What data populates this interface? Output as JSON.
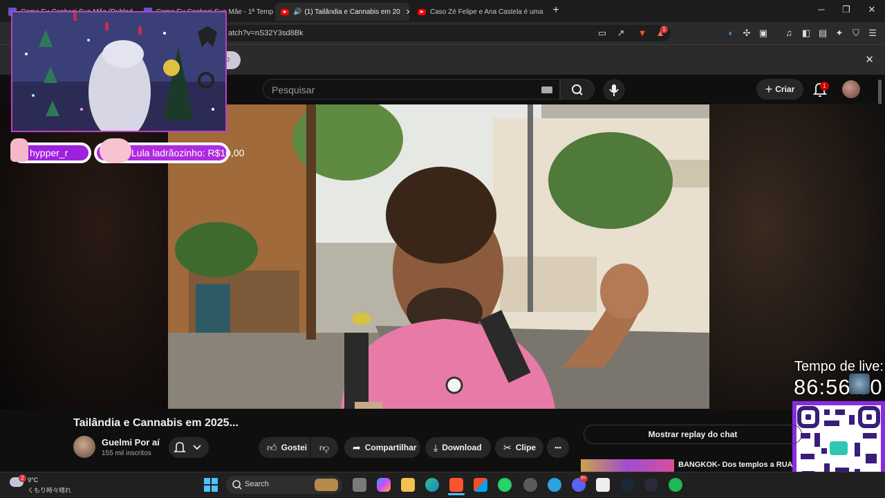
{
  "browser": {
    "tabs": [
      {
        "title": "Como Eu Conheci Sua Mãe (Dublad",
        "active": false,
        "icon": "purple-app-icon"
      },
      {
        "title": "Como Eu Conheci Sua Mãe - 1ª Temp",
        "active": false,
        "icon": "purple-app-icon"
      },
      {
        "title": "(1) Tailândia e Cannabis em 20",
        "active": true,
        "icon": "youtube-icon"
      },
      {
        "title": "Caso Zé Felipe e Ana Castela é uma",
        "active": false,
        "icon": "youtube-icon"
      }
    ],
    "new_tab_symbol": "+",
    "url": "atch?v=nS32Y3sd8Bk",
    "extension_badge": "1",
    "window_controls": {
      "minimize": "─",
      "restore": "❐",
      "close": "✕"
    }
  },
  "notice": {
    "close": "✕",
    "pill_text": "o"
  },
  "youtube_header": {
    "search_placeholder": "Pesquisar",
    "create_label": "Criar",
    "notification_count": "1"
  },
  "overlay": {
    "chat": [
      {
        "user": "hypper_r"
      },
      {
        "message": "Lula ladrãozinho: R$10,00"
      }
    ],
    "live_label": "Tempo de live:",
    "live_time": "86:56:00"
  },
  "video": {
    "title": "Tailândia e Cannabis em 2025...",
    "channel": {
      "name": "Guelmi Por aí",
      "subscribers": "155 mil inscritos"
    },
    "actions": {
      "like": "Gostei",
      "share": "Compartilhar",
      "download": "Download",
      "clip": "Clipe",
      "more": "•••"
    }
  },
  "sidebar": {
    "replay_chat": "Mostrar replay do chat",
    "related_title": "BANGKOK- Dos templos a RUA"
  },
  "taskbar": {
    "weather_temp": "9°C",
    "weather_desc": "くもり時々晴れ",
    "weather_badge": "2",
    "search_label": "Search",
    "discord_badge": "9+"
  },
  "colors": {
    "accent": "#ff0000",
    "overlay_purple": "#a020e0",
    "qr_border": "#8a2be2"
  }
}
